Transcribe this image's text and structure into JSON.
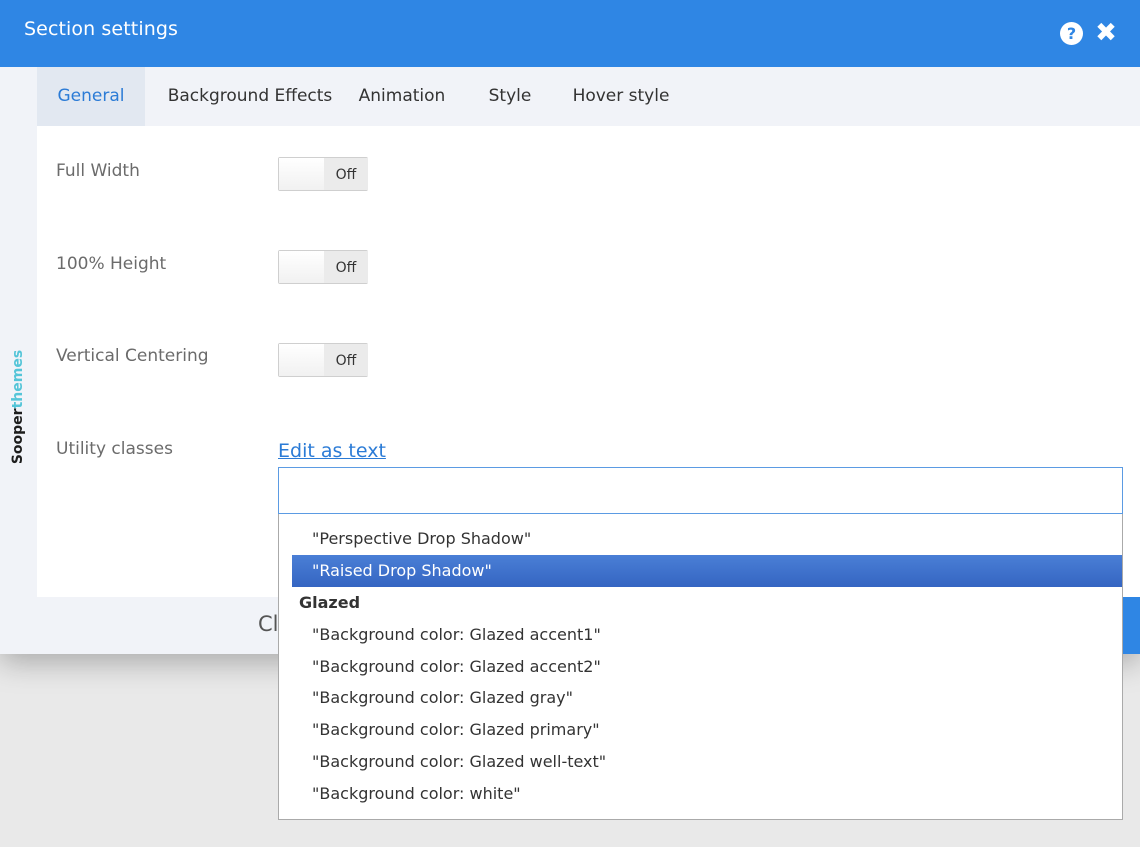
{
  "dialog": {
    "title": "Section settings",
    "help_icon": "question-circle-icon",
    "close_icon": "close-x-icon",
    "help_glyph": "?",
    "close_glyph": "✖"
  },
  "brand": {
    "part1": "Sooper",
    "part2": "themes"
  },
  "tabs": [
    {
      "label": "General",
      "active": true
    },
    {
      "label": "Background Effects"
    },
    {
      "label": "Animation"
    },
    {
      "label": "Style"
    },
    {
      "label": "Hover style"
    }
  ],
  "form": {
    "full_width": {
      "label": "Full Width",
      "state": "Off"
    },
    "height": {
      "label": "100% Height",
      "state": "Off"
    },
    "vertical_centering": {
      "label": "Vertical Centering",
      "state": "Off"
    },
    "utility_classes": {
      "label": "Utility classes",
      "edit_link": "Edit as text",
      "value": ""
    }
  },
  "footer": {
    "close_partial": "Cl"
  },
  "dropdown": {
    "items": [
      {
        "kind": "option",
        "text": "\"Perspective Drop Shadow\""
      },
      {
        "kind": "option",
        "text": "\"Raised Drop Shadow\"",
        "selected": true
      },
      {
        "kind": "group",
        "text": "Glazed"
      },
      {
        "kind": "option",
        "text": "\"Background color: Glazed accent1\""
      },
      {
        "kind": "option",
        "text": "\"Background color: Glazed accent2\""
      },
      {
        "kind": "option",
        "text": "\"Background color: Glazed gray\""
      },
      {
        "kind": "option",
        "text": "\"Background color: Glazed primary\""
      },
      {
        "kind": "option",
        "text": "\"Background color: Glazed well-text\""
      },
      {
        "kind": "option",
        "text": "\"Background color: white\""
      }
    ]
  },
  "colors": {
    "accent": "#2f86e4",
    "selected_option": "#3a6fcf",
    "link": "#2b7bd6",
    "brand_themes": "#55c5d8"
  }
}
